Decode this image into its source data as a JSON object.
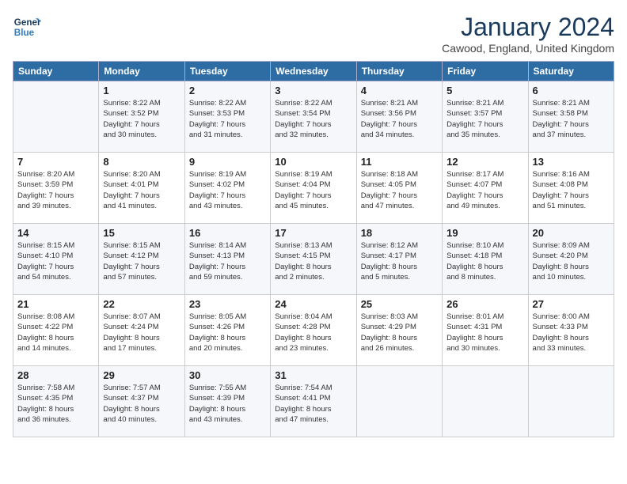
{
  "logo": {
    "line1": "General",
    "line2": "Blue"
  },
  "title": "January 2024",
  "location": "Cawood, England, United Kingdom",
  "days_of_week": [
    "Sunday",
    "Monday",
    "Tuesday",
    "Wednesday",
    "Thursday",
    "Friday",
    "Saturday"
  ],
  "weeks": [
    [
      {
        "day": "",
        "info": ""
      },
      {
        "day": "1",
        "info": "Sunrise: 8:22 AM\nSunset: 3:52 PM\nDaylight: 7 hours\nand 30 minutes."
      },
      {
        "day": "2",
        "info": "Sunrise: 8:22 AM\nSunset: 3:53 PM\nDaylight: 7 hours\nand 31 minutes."
      },
      {
        "day": "3",
        "info": "Sunrise: 8:22 AM\nSunset: 3:54 PM\nDaylight: 7 hours\nand 32 minutes."
      },
      {
        "day": "4",
        "info": "Sunrise: 8:21 AM\nSunset: 3:56 PM\nDaylight: 7 hours\nand 34 minutes."
      },
      {
        "day": "5",
        "info": "Sunrise: 8:21 AM\nSunset: 3:57 PM\nDaylight: 7 hours\nand 35 minutes."
      },
      {
        "day": "6",
        "info": "Sunrise: 8:21 AM\nSunset: 3:58 PM\nDaylight: 7 hours\nand 37 minutes."
      }
    ],
    [
      {
        "day": "7",
        "info": "Sunrise: 8:20 AM\nSunset: 3:59 PM\nDaylight: 7 hours\nand 39 minutes."
      },
      {
        "day": "8",
        "info": "Sunrise: 8:20 AM\nSunset: 4:01 PM\nDaylight: 7 hours\nand 41 minutes."
      },
      {
        "day": "9",
        "info": "Sunrise: 8:19 AM\nSunset: 4:02 PM\nDaylight: 7 hours\nand 43 minutes."
      },
      {
        "day": "10",
        "info": "Sunrise: 8:19 AM\nSunset: 4:04 PM\nDaylight: 7 hours\nand 45 minutes."
      },
      {
        "day": "11",
        "info": "Sunrise: 8:18 AM\nSunset: 4:05 PM\nDaylight: 7 hours\nand 47 minutes."
      },
      {
        "day": "12",
        "info": "Sunrise: 8:17 AM\nSunset: 4:07 PM\nDaylight: 7 hours\nand 49 minutes."
      },
      {
        "day": "13",
        "info": "Sunrise: 8:16 AM\nSunset: 4:08 PM\nDaylight: 7 hours\nand 51 minutes."
      }
    ],
    [
      {
        "day": "14",
        "info": "Sunrise: 8:15 AM\nSunset: 4:10 PM\nDaylight: 7 hours\nand 54 minutes."
      },
      {
        "day": "15",
        "info": "Sunrise: 8:15 AM\nSunset: 4:12 PM\nDaylight: 7 hours\nand 57 minutes."
      },
      {
        "day": "16",
        "info": "Sunrise: 8:14 AM\nSunset: 4:13 PM\nDaylight: 7 hours\nand 59 minutes."
      },
      {
        "day": "17",
        "info": "Sunrise: 8:13 AM\nSunset: 4:15 PM\nDaylight: 8 hours\nand 2 minutes."
      },
      {
        "day": "18",
        "info": "Sunrise: 8:12 AM\nSunset: 4:17 PM\nDaylight: 8 hours\nand 5 minutes."
      },
      {
        "day": "19",
        "info": "Sunrise: 8:10 AM\nSunset: 4:18 PM\nDaylight: 8 hours\nand 8 minutes."
      },
      {
        "day": "20",
        "info": "Sunrise: 8:09 AM\nSunset: 4:20 PM\nDaylight: 8 hours\nand 10 minutes."
      }
    ],
    [
      {
        "day": "21",
        "info": "Sunrise: 8:08 AM\nSunset: 4:22 PM\nDaylight: 8 hours\nand 14 minutes."
      },
      {
        "day": "22",
        "info": "Sunrise: 8:07 AM\nSunset: 4:24 PM\nDaylight: 8 hours\nand 17 minutes."
      },
      {
        "day": "23",
        "info": "Sunrise: 8:05 AM\nSunset: 4:26 PM\nDaylight: 8 hours\nand 20 minutes."
      },
      {
        "day": "24",
        "info": "Sunrise: 8:04 AM\nSunset: 4:28 PM\nDaylight: 8 hours\nand 23 minutes."
      },
      {
        "day": "25",
        "info": "Sunrise: 8:03 AM\nSunset: 4:29 PM\nDaylight: 8 hours\nand 26 minutes."
      },
      {
        "day": "26",
        "info": "Sunrise: 8:01 AM\nSunset: 4:31 PM\nDaylight: 8 hours\nand 30 minutes."
      },
      {
        "day": "27",
        "info": "Sunrise: 8:00 AM\nSunset: 4:33 PM\nDaylight: 8 hours\nand 33 minutes."
      }
    ],
    [
      {
        "day": "28",
        "info": "Sunrise: 7:58 AM\nSunset: 4:35 PM\nDaylight: 8 hours\nand 36 minutes."
      },
      {
        "day": "29",
        "info": "Sunrise: 7:57 AM\nSunset: 4:37 PM\nDaylight: 8 hours\nand 40 minutes."
      },
      {
        "day": "30",
        "info": "Sunrise: 7:55 AM\nSunset: 4:39 PM\nDaylight: 8 hours\nand 43 minutes."
      },
      {
        "day": "31",
        "info": "Sunrise: 7:54 AM\nSunset: 4:41 PM\nDaylight: 8 hours\nand 47 minutes."
      },
      {
        "day": "",
        "info": ""
      },
      {
        "day": "",
        "info": ""
      },
      {
        "day": "",
        "info": ""
      }
    ]
  ]
}
